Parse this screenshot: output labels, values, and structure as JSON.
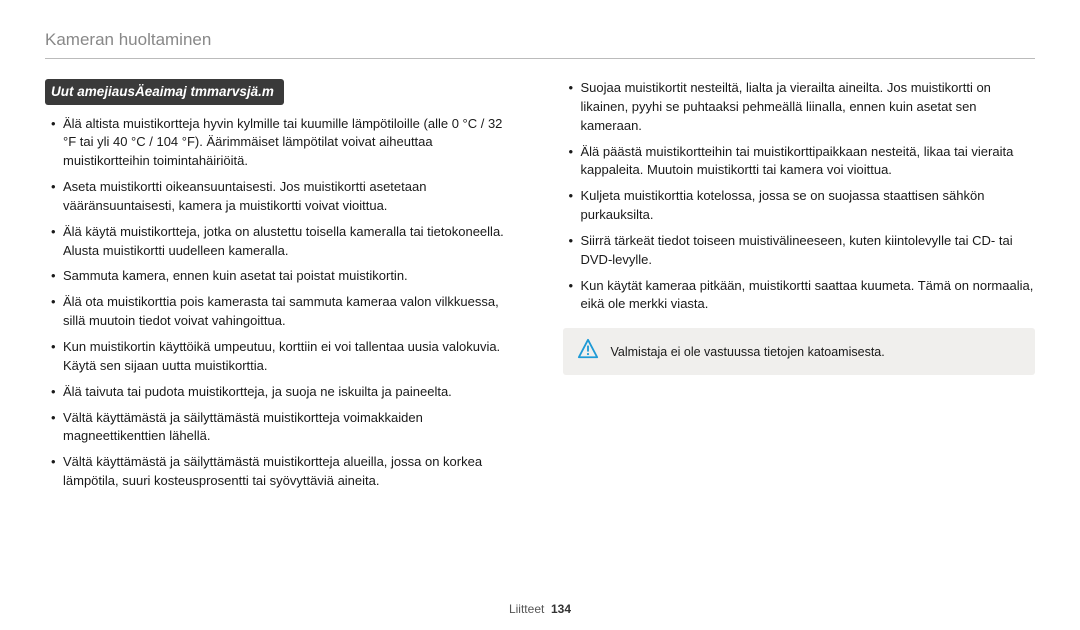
{
  "header": {
    "title": "Kameran huoltaminen"
  },
  "left": {
    "section_label": "Uut amejiausÄeaimaj tmmarvsjä.m",
    "items": [
      "Älä altista muistikortteja hyvin kylmille tai kuumille lämpötiloille (alle 0 °C / 32 °F tai yli 40 °C / 104 °F). Äärimmäiset lämpötilat voivat aiheuttaa muistikortteihin toimintahäiriöitä.",
      "Aseta muistikortti oikeansuuntaisesti. Jos muistikortti asetetaan vääränsuuntaisesti, kamera ja muistikortti voivat vioittua.",
      "Älä käytä muistikortteja, jotka on alustettu toisella kameralla tai tietokoneella. Alusta muistikortti uudelleen kameralla.",
      "Sammuta kamera, ennen kuin asetat tai poistat muistikortin.",
      "Älä ota muistikorttia pois kamerasta tai sammuta kameraa valon vilkkuessa, sillä muutoin tiedot voivat vahingoittua.",
      "Kun muistikortin käyttöikä umpeutuu, korttiin ei voi tallentaa uusia valokuvia. Käytä sen sijaan uutta muistikorttia.",
      "Älä taivuta tai pudota muistikortteja, ja suoja ne iskuilta ja paineelta.",
      "Vältä käyttämästä ja säilyttämästä muistikortteja voimakkaiden magneettikenttien lähellä.",
      "Vältä käyttämästä ja säilyttämästä muistikortteja alueilla, jossa on korkea lämpötila, suuri kosteusprosentti tai syövyttäviä aineita."
    ]
  },
  "right": {
    "items": [
      "Suojaa muistikortit nesteiltä, lialta ja vierailta aineilta. Jos muistikortti on likainen, pyyhi se puhtaaksi pehmeällä liinalla, ennen kuin asetat sen kameraan.",
      "Älä päästä muistikortteihin tai muistikorttipaikkaan nesteitä, likaa tai vieraita kappaleita. Muutoin muistikortti tai kamera voi vioittua.",
      "Kuljeta muistikorttia kotelossa, jossa se on suojassa staattisen sähkön purkauksilta.",
      "Siirrä tärkeät tiedot toiseen muistivälineeseen, kuten kiintolevylle tai CD- tai DVD-levylle.",
      "Kun käytät kameraa pitkään, muistikortti saattaa kuumeta. Tämä on normaalia, eikä ole merkki viasta."
    ],
    "note": "Valmistaja ei ole vastuussa tietojen katoamisesta."
  },
  "footer": {
    "section": "Liitteet",
    "page": "134"
  }
}
